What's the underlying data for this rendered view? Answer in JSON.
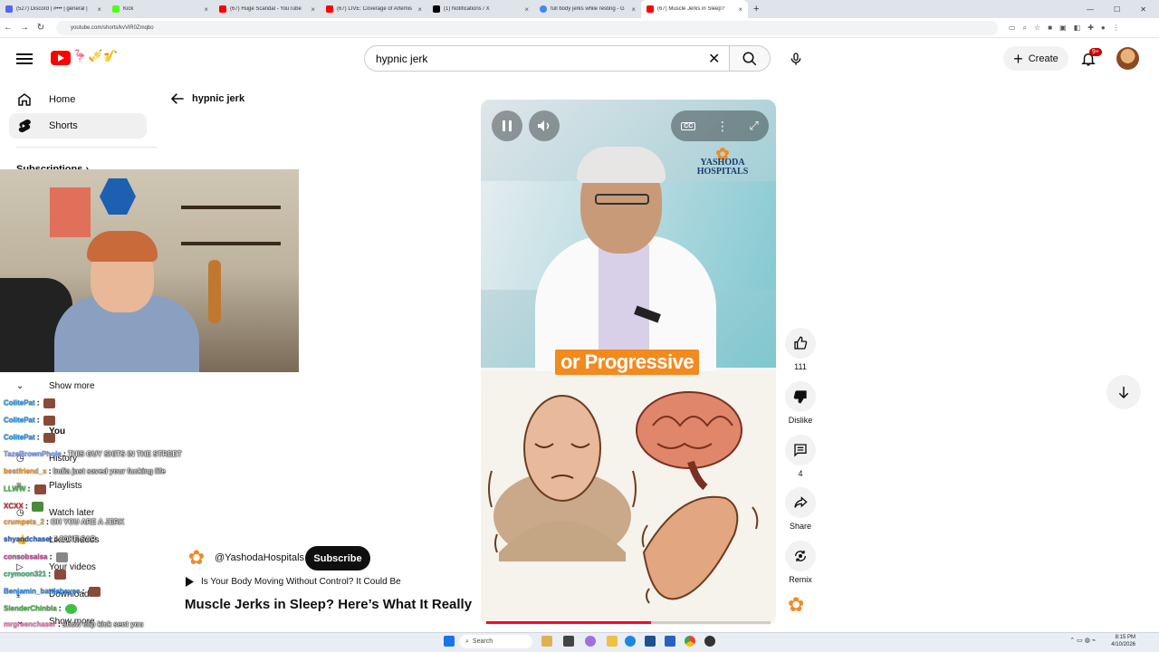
{
  "browser": {
    "tabs": [
      {
        "title": "(527) Discord | #••• | general |",
        "color": "#5865f2"
      },
      {
        "title": "Kick",
        "color": "#53fc18"
      },
      {
        "title": "(67) Huge Scandal - YouTube",
        "color": "#ff0000"
      },
      {
        "title": "(67) LIVE: Coverage of Artemis",
        "color": "#ff0000"
      },
      {
        "title": "(1) Notifications / X",
        "color": "#000000"
      },
      {
        "title": "full body jerks while resting - G",
        "color": "#4285f4"
      },
      {
        "title": "(67) Muscle Jerks in Sleep?",
        "color": "#ff0000",
        "active": true
      }
    ],
    "url": "youtube.com/shorts/kvViR0Zmqbo"
  },
  "header": {
    "search_value": "hypnic jerk",
    "create_label": "Create",
    "notification_count": "9+"
  },
  "sidebar": {
    "home": "Home",
    "shorts": "Shorts",
    "subscriptions": "Subscriptions",
    "show_more": "Show more",
    "you": "You",
    "history": "History",
    "playlists": "Playlists",
    "watch_later": "Watch later",
    "liked_videos": "Liked videos",
    "your_videos": "Your videos",
    "downloads": "Downloads",
    "show_more_2": "Show more"
  },
  "back": {
    "label": "hypnic jerk"
  },
  "chat": [
    {
      "user": "ColitePat",
      "color": "#1fa0ff",
      "msg": ""
    },
    {
      "user": "ColitePat",
      "color": "#1fa0ff",
      "msg": ""
    },
    {
      "user": "ColitePat",
      "color": "#1fa0ff",
      "msg": ""
    },
    {
      "user": "TazeBrownPhole",
      "color": "#7aa0ff",
      "msg": "THIS GUY SHITS IN THE STREET"
    },
    {
      "user": "bestfriend_x",
      "color": "#ffa030",
      "msg": "India just saved your fucking life"
    },
    {
      "user": "LLWW",
      "color": "#4ac24a",
      "msg": ""
    },
    {
      "user": "XCXX",
      "color": "#d03030",
      "msg": ""
    },
    {
      "user": "crumpets_2",
      "color": "#ffa030",
      "msg": "OH YOU ARE A JERK"
    },
    {
      "user": "shyandchaser",
      "color": "#3a6ad0",
      "msg": "JOKE SAR"
    },
    {
      "user": "consobsalsa",
      "color": "#d050a0",
      "msg": ""
    },
    {
      "user": "crymoon321",
      "color": "#40c080",
      "msg": ""
    },
    {
      "user": "Benjamin_battlebeyee",
      "color": "#3090ff",
      "msg": ""
    },
    {
      "user": "SlenderChinbla",
      "color": "#40c040",
      "msg": ""
    },
    {
      "user": "mrgreenchaser",
      "color": "#ff80c0",
      "msg": "show clip kick sent you"
    }
  ],
  "video": {
    "caption": "or Progressive",
    "brand_line1": "YASHODA",
    "brand_line2": "HOSPITALS",
    "progress": 0.58
  },
  "channel": {
    "name": "@YashodaHospitals",
    "subscribe": "Subscribe",
    "playlist_line": "Is Your Body Moving Without Control? It Could Be",
    "title": "Muscle Jerks in Sleep? Here’s What It Really ..."
  },
  "actions": {
    "likes": "111",
    "dislike": "Dislike",
    "comments": "4",
    "share": "Share",
    "remix": "Remix"
  },
  "taskbar": {
    "search": "Search",
    "time": "8:15 PM",
    "date": "4/10/2026"
  }
}
